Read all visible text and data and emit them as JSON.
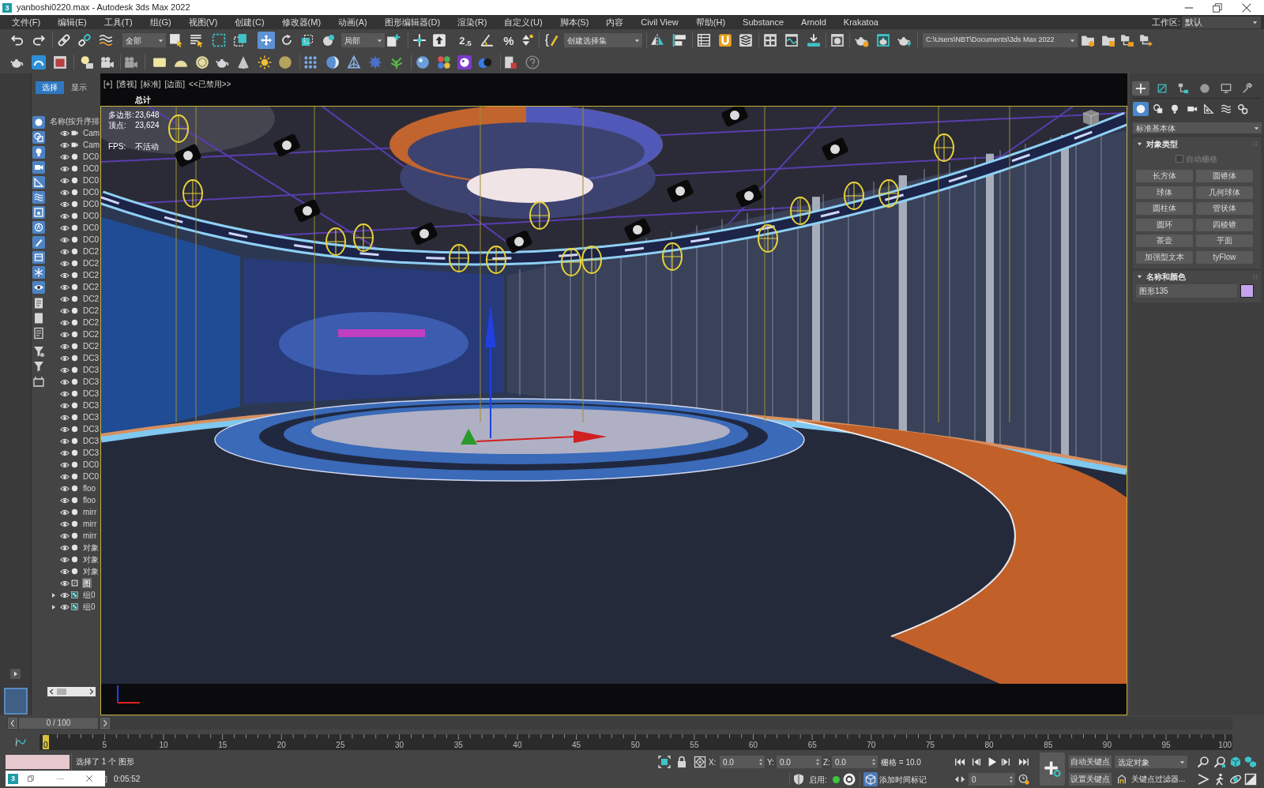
{
  "window": {
    "title": "yanboshi0220.max - Autodesk 3ds Max 2022",
    "app_badge": "3"
  },
  "menu_bar": {
    "items": [
      "文件(F)",
      "编辑(E)",
      "工具(T)",
      "组(G)",
      "视图(V)",
      "创建(C)",
      "修改器(M)",
      "动画(A)",
      "图形编辑器(D)",
      "渲染(R)",
      "自定义(U)",
      "脚本(S)",
      "内容",
      "Civil View",
      "帮助(H)",
      "Substance",
      "Arnold",
      "Krakatoa"
    ],
    "workspace_label": "工作区:",
    "workspace": "默认"
  },
  "main_toolbar": {
    "selection_filter": "全部",
    "transform_tools": [
      {
        "selected": true
      },
      {
        "selected": false
      },
      {
        "selected": false
      },
      {
        "selected": false
      }
    ],
    "reference_coordinate_system": "局部",
    "snap_glyph": "2$_{.5}$",
    "percent_snap_glyph": "%",
    "named_selection_set": "创建选择集",
    "project_folder": "C:\\Users\\NBT\\Documents\\3ds Max 2022"
  },
  "scene_explorer": {
    "tabs": [
      {
        "label": "选择",
        "selected": true
      },
      {
        "label": "显示",
        "selected": false
      }
    ],
    "filters": [
      {
        "on": true
      },
      {
        "on": true
      },
      {
        "on": true
      },
      {
        "on": true
      },
      {
        "on": true
      },
      {
        "on": true
      },
      {
        "on": true
      },
      {
        "on": true
      },
      {
        "on": true
      },
      {
        "on": true
      },
      {
        "on": true
      },
      {
        "on": true
      }
    ],
    "column_header": "名称(按升序排",
    "rows": [
      {
        "name": "Cam",
        "kind": "camera",
        "selected": false
      },
      {
        "name": "Cam",
        "kind": "camera",
        "selected": false
      },
      {
        "name": "DC0",
        "kind": "object",
        "selected": false
      },
      {
        "name": "DC0",
        "kind": "object",
        "selected": false
      },
      {
        "name": "DC0",
        "kind": "object",
        "selected": false
      },
      {
        "name": "DC0",
        "kind": "object",
        "selected": false
      },
      {
        "name": "DC0",
        "kind": "object",
        "selected": false
      },
      {
        "name": "DC0",
        "kind": "object",
        "selected": false
      },
      {
        "name": "DC0",
        "kind": "object",
        "selected": false
      },
      {
        "name": "DC0",
        "kind": "object",
        "selected": false
      },
      {
        "name": "DC2",
        "kind": "object",
        "selected": false
      },
      {
        "name": "DC2",
        "kind": "object",
        "selected": false
      },
      {
        "name": "DC2",
        "kind": "object",
        "selected": false
      },
      {
        "name": "DC2",
        "kind": "object",
        "selected": false
      },
      {
        "name": "DC2",
        "kind": "object",
        "selected": false
      },
      {
        "name": "DC2",
        "kind": "object",
        "selected": false
      },
      {
        "name": "DC2",
        "kind": "object",
        "selected": false
      },
      {
        "name": "DC2",
        "kind": "object",
        "selected": false
      },
      {
        "name": "DC2",
        "kind": "object",
        "selected": false
      },
      {
        "name": "DC3",
        "kind": "object",
        "selected": false
      },
      {
        "name": "DC3",
        "kind": "object",
        "selected": false
      },
      {
        "name": "DC3",
        "kind": "object",
        "selected": false
      },
      {
        "name": "DC3",
        "kind": "object",
        "selected": false
      },
      {
        "name": "DC3",
        "kind": "object",
        "selected": false
      },
      {
        "name": "DC3",
        "kind": "object",
        "selected": false
      },
      {
        "name": "DC3",
        "kind": "object",
        "selected": false
      },
      {
        "name": "DC3",
        "kind": "object",
        "selected": false
      },
      {
        "name": "DC3",
        "kind": "object",
        "selected": false
      },
      {
        "name": "DC0",
        "kind": "object",
        "selected": false
      },
      {
        "name": "DC0",
        "kind": "object",
        "selected": false
      },
      {
        "name": "floo",
        "kind": "object",
        "selected": false
      },
      {
        "name": "floo",
        "kind": "object",
        "selected": false
      },
      {
        "name": "mirr",
        "kind": "object",
        "selected": false
      },
      {
        "name": "mirr",
        "kind": "object",
        "selected": false
      },
      {
        "name": "mirr",
        "kind": "object",
        "selected": false
      },
      {
        "name": "对象",
        "kind": "object",
        "selected": false
      },
      {
        "name": "对象",
        "kind": "object",
        "selected": false
      },
      {
        "name": "对象",
        "kind": "object",
        "selected": false
      },
      {
        "name": "图",
        "kind": "shape",
        "selected": true
      },
      {
        "name": "组0",
        "kind": "group",
        "selected": false
      },
      {
        "name": "组0",
        "kind": "group",
        "selected": false
      }
    ]
  },
  "viewport": {
    "labels": [
      "[+]",
      "[透视]",
      "[标准]",
      "[边面]",
      "<<已禁用>>"
    ],
    "active": true,
    "statistics": {
      "title": "总计",
      "counts": [
        {
          "label": "多边形:",
          "value": "23,648"
        },
        {
          "label": "顶点:",
          "value": "23,624"
        }
      ],
      "fps": {
        "label": "FPS:",
        "value": "不活动"
      }
    }
  },
  "command_panel": {
    "tabs": [
      {
        "selected": true
      },
      {
        "selected": false
      },
      {
        "selected": false
      },
      {
        "selected": false
      },
      {
        "selected": false
      },
      {
        "selected": false
      }
    ],
    "categories": [
      {
        "selected": true
      },
      {
        "selected": false
      },
      {
        "selected": false
      },
      {
        "selected": false
      },
      {
        "selected": false
      },
      {
        "selected": false
      },
      {
        "selected": false
      }
    ],
    "category_dropdown": "标准基本体",
    "object_type": {
      "title": "对象类型",
      "expanded": true,
      "auto_grid": {
        "label": "自动栅格",
        "checked": false,
        "disabled": true
      },
      "buttons": [
        "长方体",
        "圆锥体",
        "球体",
        "几何球体",
        "圆柱体",
        "管状体",
        "圆环",
        "四棱锥",
        "茶壶",
        "平面",
        "加强型文本",
        "tyFlow"
      ]
    },
    "name_and_color": {
      "title": "名称和颜色",
      "expanded": true,
      "name": "图形135",
      "color": "#c4a4ee"
    }
  },
  "time_slider": {
    "position": "0 / 100",
    "level": 0
  },
  "trackbar": {
    "frame_labels": [
      "0",
      "5",
      "10",
      "15",
      "20",
      "25",
      "30",
      "35",
      "40",
      "45",
      "50",
      "55",
      "60",
      "65",
      "70",
      "75",
      "80",
      "85",
      "90",
      "95",
      "100"
    ]
  },
  "status_bar": {
    "prompt": "选择了 1 个 图形",
    "elapsed_time": "0:05:52",
    "mini_window_badge": "3",
    "coordinates": [
      {
        "axis": "X:",
        "value": "0.0"
      },
      {
        "axis": "Y:",
        "value": "0.0"
      },
      {
        "axis": "Z:",
        "value": "0.0"
      }
    ],
    "grid": "栅格 = 10.0",
    "adaptive_degradation": {
      "label": "启用:",
      "on": true
    },
    "time_tag": "添加时间标记",
    "current_frame": "0",
    "auto_key": "自动关键点",
    "set_key": "设置关键点",
    "key_target": "选定对象",
    "key_filters": "关键点过滤器..."
  }
}
